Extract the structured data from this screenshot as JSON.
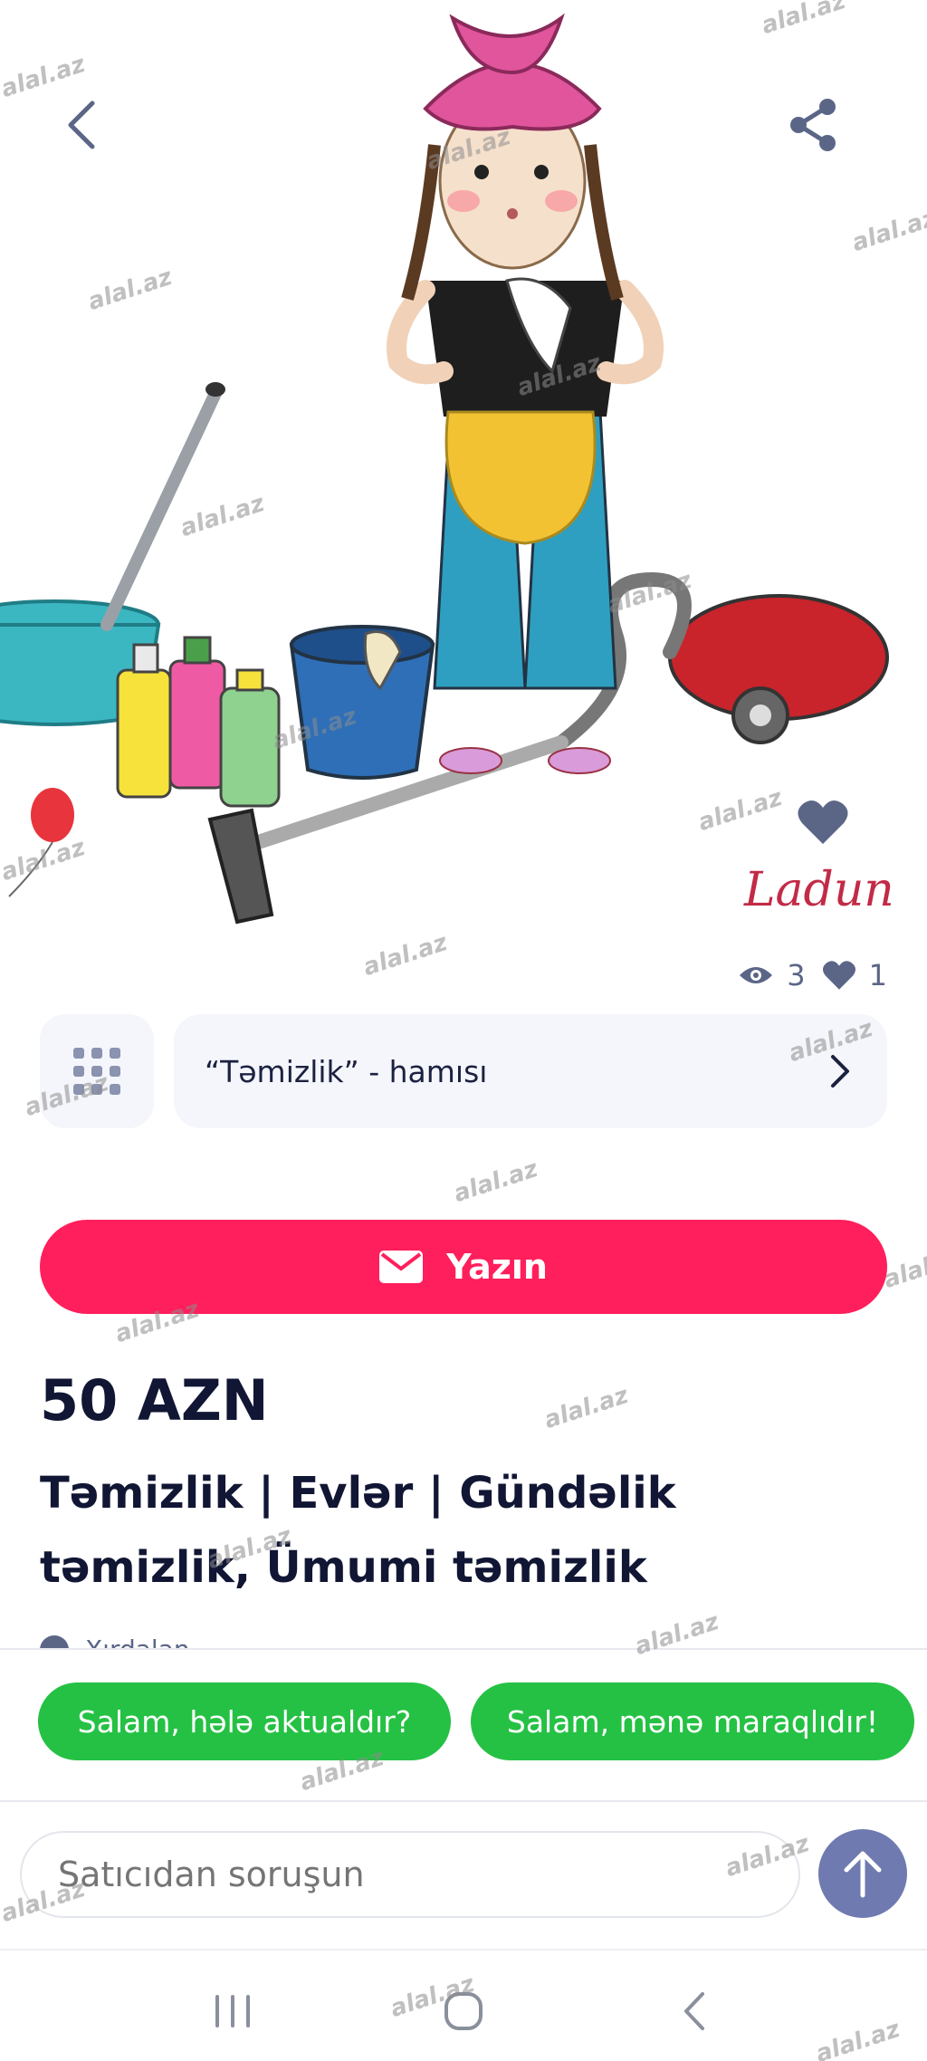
{
  "hero": {
    "image_alt": "cleaning-illustration",
    "logo_partial_text": "Ladun"
  },
  "stats": {
    "views": "3",
    "likes": "1"
  },
  "category": {
    "label": "“Təmizlik” - hamısı"
  },
  "actions": {
    "write_label": "Yazın"
  },
  "listing": {
    "price": "50 AZN",
    "title": "Təmizlik | Evlər | Gündəlik təmizlik, Ümumi təmizlik",
    "meta_partial": "Xırdalan"
  },
  "quick_replies": [
    "Salam, hələ aktualdır?",
    "Salam, mənə maraqlıdır!"
  ],
  "chat": {
    "placeholder": "Satıcıdan soruşun"
  },
  "watermark": "alal.az",
  "colors": {
    "accent": "#ff1f5c",
    "quick_reply": "#25c144",
    "send": "#6f7ab0",
    "icon": "#5b6687"
  }
}
